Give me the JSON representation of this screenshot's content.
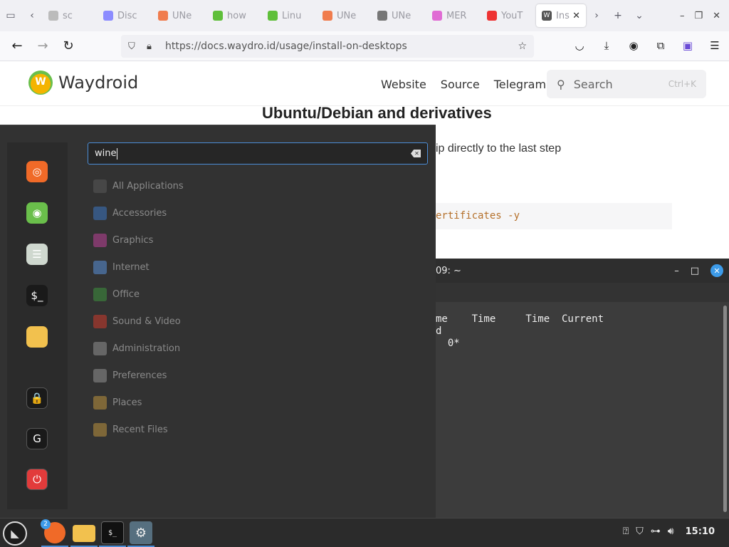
{
  "browser": {
    "tabs": [
      {
        "label": "sc",
        "color": "#bbbbbb"
      },
      {
        "label": "Disc",
        "color": "#8c8cff"
      },
      {
        "label": "UNe",
        "color": "#f07c4d"
      },
      {
        "label": "how",
        "color": "#5fbf3a"
      },
      {
        "label": "Linu",
        "color": "#5fbf3a"
      },
      {
        "label": "UNe",
        "color": "#f07c4d"
      },
      {
        "label": "UNe",
        "color": "#777777"
      },
      {
        "label": "MER",
        "color": "#e06bd4"
      },
      {
        "label": "YouT",
        "color": "#ee3333"
      }
    ],
    "active_tab": {
      "label": "Ins",
      "icon": "W"
    },
    "url": "https://docs.waydro.id/usage/install-on-desktops"
  },
  "site": {
    "brand": "Waydroid",
    "nav": [
      "Website",
      "Source",
      "Telegram"
    ],
    "search_label": "Search",
    "search_shortcut": "Ctrl+K",
    "heading": "Ubuntu/Debian and derivatives",
    "text_fragment": "ip directly to the last step",
    "code_fragment": "ertificates -y"
  },
  "terminal": {
    "title": "09: ~",
    "lines": [
      "me    Time     Time  Current",
      "d",
      "  0*"
    ]
  },
  "menu": {
    "search_value": "wine",
    "categories": [
      {
        "label": "All Applications",
        "icon": "grid-icon",
        "color": "#555555"
      },
      {
        "label": "Accessories",
        "icon": "scissors-icon",
        "color": "#3b6fb5"
      },
      {
        "label": "Graphics",
        "icon": "palette-icon",
        "color": "#b0408f"
      },
      {
        "label": "Internet",
        "icon": "cloud-icon",
        "color": "#5588cc"
      },
      {
        "label": "Office",
        "icon": "spreadsheet-icon",
        "color": "#3c8a3c"
      },
      {
        "label": "Sound & Video",
        "icon": "play-icon",
        "color": "#c0392b"
      },
      {
        "label": "Administration",
        "icon": "admin-icon",
        "color": "#888888"
      },
      {
        "label": "Preferences",
        "icon": "preferences-icon",
        "color": "#888888"
      },
      {
        "label": "Places",
        "icon": "folder-icon",
        "color": "#b08a3c"
      },
      {
        "label": "Recent Files",
        "icon": "folder-recent-icon",
        "color": "#b08a3c"
      }
    ],
    "favorites": [
      {
        "name": "firefox-icon",
        "color": "#f06a28",
        "glyph": "◎"
      },
      {
        "name": "software-manager-icon",
        "color": "#6abf4b",
        "glyph": "◉"
      },
      {
        "name": "settings-toggle-icon",
        "color": "#cfd8cf",
        "glyph": "☰"
      },
      {
        "name": "terminal-icon",
        "color": "#1a1a1a",
        "glyph": "$_"
      },
      {
        "name": "files-folder-icon",
        "color": "#f2c14e",
        "glyph": ""
      }
    ],
    "session": [
      {
        "name": "lock-screen-icon",
        "color": "#1a1a1a",
        "glyph": "🔒"
      },
      {
        "name": "logout-icon",
        "color": "#1a1a1a",
        "glyph": "G"
      },
      {
        "name": "shutdown-icon",
        "color": "#e23b3b",
        "glyph": "⏻"
      }
    ]
  },
  "panel": {
    "firefox_badge": "2",
    "clock": "15:10"
  }
}
